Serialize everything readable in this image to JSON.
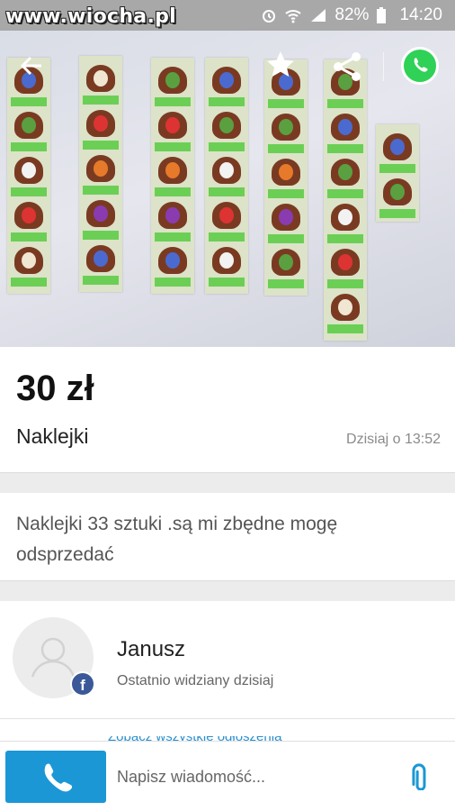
{
  "status_bar": {
    "watermark": "www.wiocha.pl",
    "battery": "82%",
    "time": "14:20"
  },
  "listing": {
    "price": "30 zł",
    "title": "Naklejki",
    "posted": "Dzisiaj o 13:52",
    "description": "Naklejki 33 sztuki .są mi zbędne mogę odsprzedać"
  },
  "seller": {
    "name": "Janusz",
    "last_seen": "Ostatnio widziany dzisiaj",
    "badge": "f",
    "more_link": "Zobacz wszystkie ogłoszenia"
  },
  "bottom_bar": {
    "message_placeholder": "Napisz wiadomość..."
  },
  "colors": {
    "accent": "#1b97d6",
    "facebook": "#3b5998",
    "whatsapp": "#2fd157"
  }
}
